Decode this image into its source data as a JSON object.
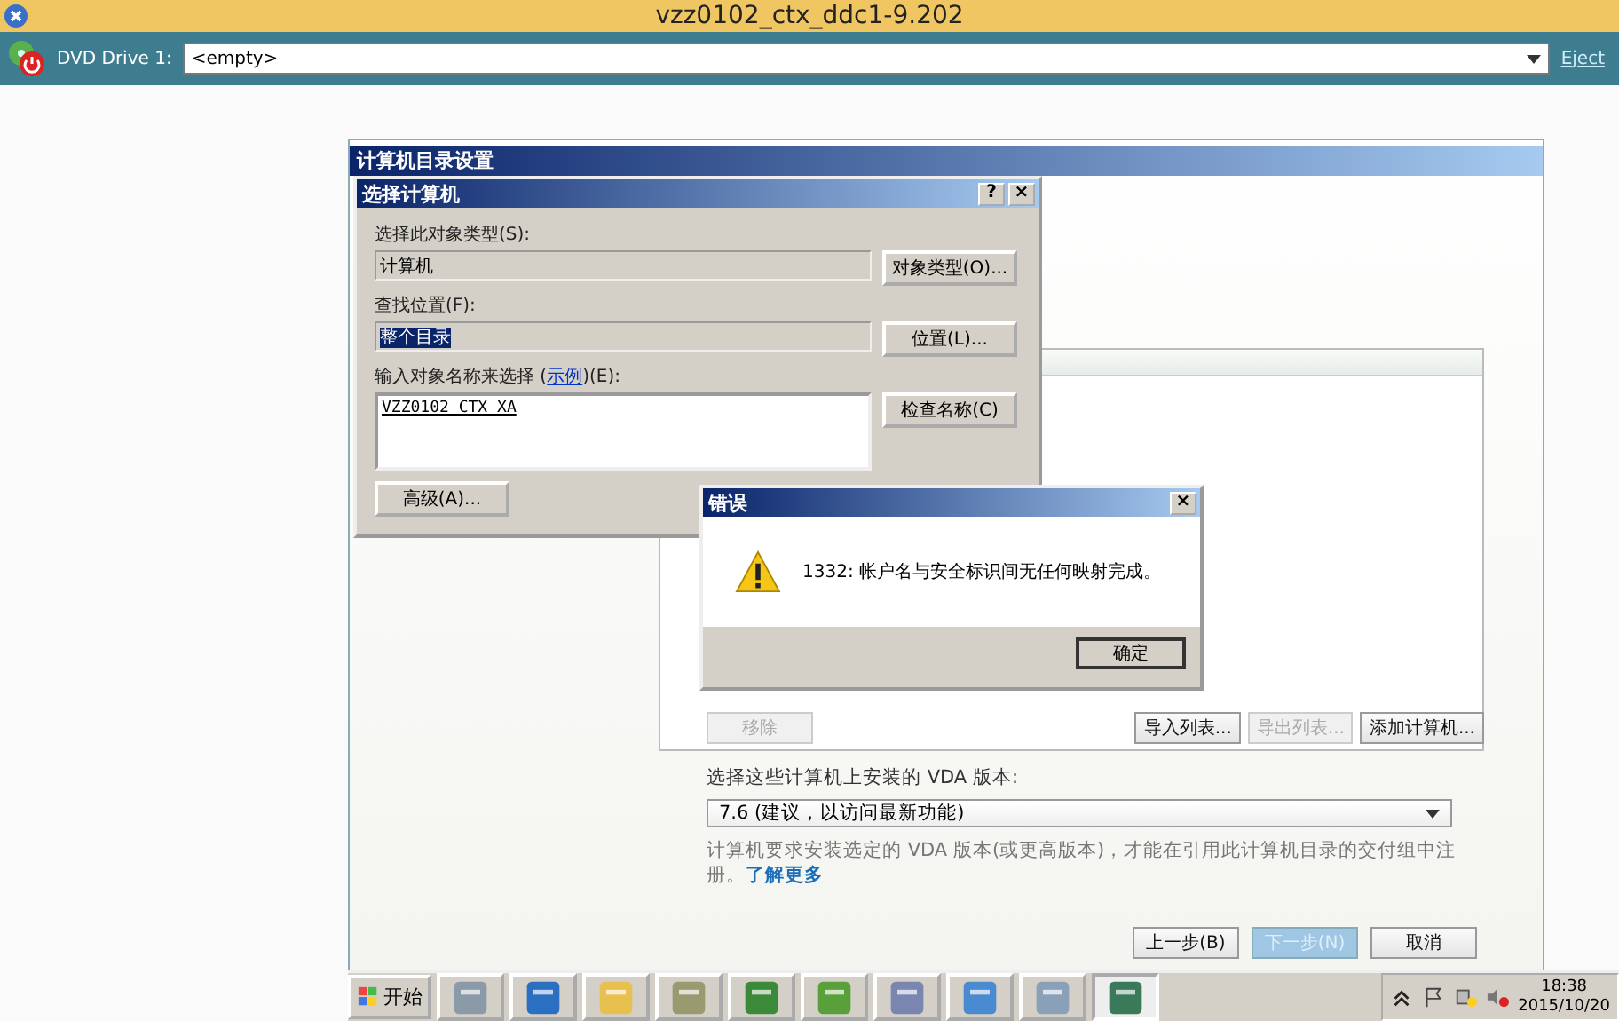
{
  "window": {
    "title": "vzz0102_ctx_ddc1-9.202"
  },
  "toolbar": {
    "label": "DVD Drive 1:",
    "value": "<empty>",
    "link": "Eject"
  },
  "wizard": {
    "title": "计算机目录设置",
    "list_buttons": [
      {
        "label": "移除",
        "disabled": true
      },
      {
        "label": "导入列表...",
        "disabled": false
      },
      {
        "label": "导出列表...",
        "disabled": true
      },
      {
        "label": "添加计算机...",
        "disabled": false
      }
    ],
    "vda_label": "选择这些计算机上安装的 VDA 版本:",
    "vda_value": "7.6 (建议，以访问最新功能)",
    "note": "计算机要求安装选定的 VDA 版本(或更高版本)，才能在引用此计算机目录的交付组中注册。",
    "note_link": "了解更多",
    "nav_buttons": [
      {
        "label": "上一步(B)",
        "disabled": false
      },
      {
        "label": "下一步(N)",
        "disabled": true
      },
      {
        "label": "取消",
        "disabled": false
      }
    ]
  },
  "select_dialog": {
    "title": "选择计算机",
    "help": "?",
    "close": "×",
    "type_label": "选择此对象类型(S):",
    "type_value": "计算机",
    "type_button": "对象类型(O)...",
    "location_label": "查找位置(F):",
    "location_value": "整个目录",
    "location_button": "位置(L)...",
    "names_label_before": "输入对象名称来选择 (",
    "names_link": "示例",
    "names_label_after": ")(E):",
    "names_value": "VZZ0102_CTX_XA",
    "check_button": "检查名称(C)",
    "advanced_button": "高级(A)..."
  },
  "error_dialog": {
    "title": "错误",
    "close": "×",
    "message": "1332: 帐户名与安全标识间无任何映射完成。",
    "ok": "确定"
  },
  "taskbar": {
    "start": "开始",
    "items": [
      {
        "kind": "server",
        "active": false
      },
      {
        "kind": "powershell",
        "active": false
      },
      {
        "kind": "folder",
        "active": false
      },
      {
        "kind": "tools",
        "active": false
      },
      {
        "kind": "monitor",
        "active": false
      },
      {
        "kind": "xapp",
        "active": false
      },
      {
        "kind": "book",
        "active": false
      },
      {
        "kind": "console",
        "active": false
      },
      {
        "kind": "gears",
        "active": false
      },
      {
        "kind": "window",
        "active": true
      }
    ],
    "time": "18:38",
    "date": "2015/10/20"
  }
}
